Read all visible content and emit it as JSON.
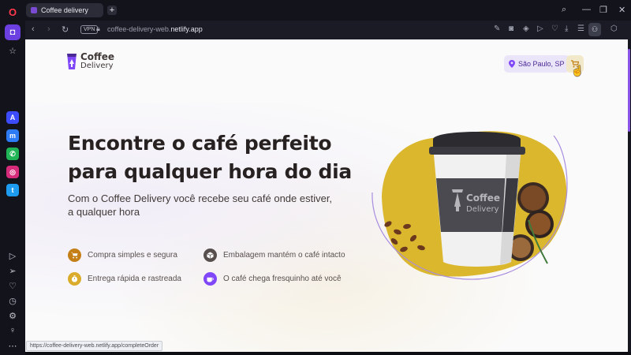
{
  "browser": {
    "tab_title": "Coffee delivery",
    "url_prefix": "coffee-delivery-web.",
    "url_domain": "netlify.app",
    "vpn_label": "VPN",
    "status_url": "https://coffee-delivery-web.netlify.app/completeOrder"
  },
  "header": {
    "brand_line1": "Coffee",
    "brand_line2": "Delivery",
    "location": "São Paulo, SP"
  },
  "hero": {
    "headline_line1": "Encontre o café perfeito",
    "headline_line2": "para qualquer hora do dia",
    "subtext": "Com o Coffee Delivery você recebe seu café onde estiver, a qualquer hora",
    "cup_brand_line1": "Coffee",
    "cup_brand_line2": "Delivery"
  },
  "features": [
    {
      "label": "Compra simples e segura",
      "color": "#c47f17"
    },
    {
      "label": "Embalagem mantém o café intacto",
      "color": "#574f4d"
    },
    {
      "label": "Entrega rápida e rastreada",
      "color": "#dbac2c"
    },
    {
      "label": "O café chega fresquinho até você",
      "color": "#8047f8"
    }
  ],
  "colors": {
    "purple": "#8047f8",
    "purple_dark": "#4b2995",
    "yellow": "#dbac2c",
    "yellow_dark": "#c47f17",
    "title": "#272221"
  }
}
